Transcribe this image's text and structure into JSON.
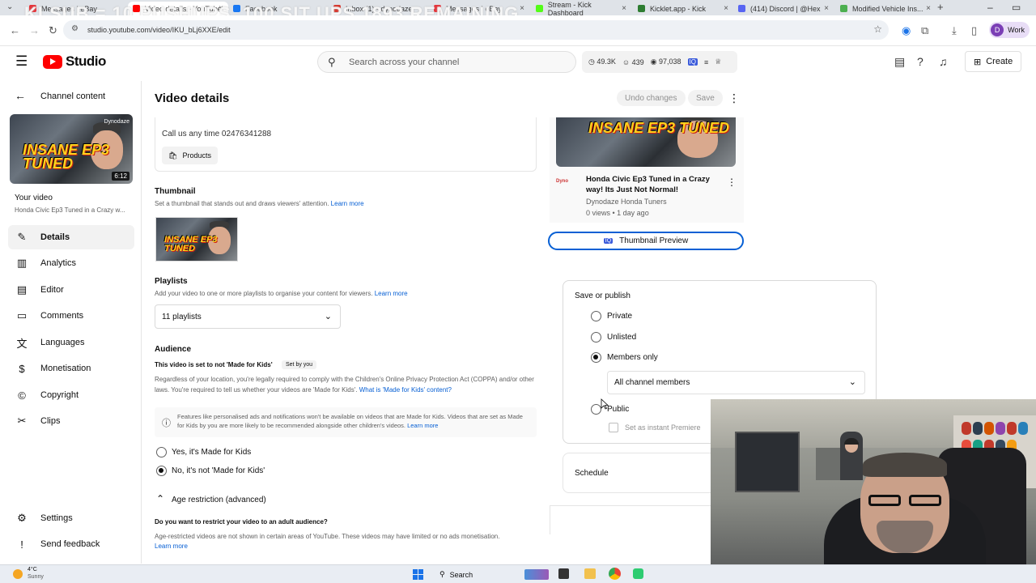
{
  "browser": {
    "overlay_text": "KI SUB = 10 PUSHUPS, 100 SIT UPS 1893 REMAINING",
    "tabs": [
      {
        "label": "Messages | eBay",
        "color": "#e53238"
      },
      {
        "label": "Video details - YouTube",
        "color": "#ff0000"
      },
      {
        "label": "Facebook",
        "color": "#1877f2"
      },
      {
        "label": "Inbox (1) - dynodaze",
        "color": "#d93025"
      },
      {
        "label": "Messages | eBay",
        "color": "#e53238"
      },
      {
        "label": "Stream - Kick Dashboard",
        "color": "#53fc18"
      },
      {
        "label": "Kicklet.app - Kick",
        "color": "#2e7d32"
      },
      {
        "label": "(414) Discord | @Hex",
        "color": "#5865f2"
      },
      {
        "label": "Modified Vehicle Ins...",
        "color": "#4caf50"
      }
    ],
    "url": "studio.youtube.com/video/IKU_bLj6XXE/edit",
    "profile_label": "Work",
    "profile_initial": "D"
  },
  "header": {
    "logo_text": "Studio",
    "search_placeholder": "Search across your channel",
    "stats": {
      "views_clock": "49.3K",
      "subs": "439",
      "views": "97,038"
    },
    "create_label": "Create"
  },
  "sidebar": {
    "back_label": "Channel content",
    "thumb_title": "INSANE EP3 TUNED",
    "thumb_brand": "Dynodaze",
    "duration": "6:12",
    "your_video_label": "Your video",
    "video_title_short": "Honda Civic Ep3 Tuned in a Crazy w...",
    "items": [
      {
        "label": "Details",
        "icon": "pencil-icon",
        "glyph": "✎"
      },
      {
        "label": "Analytics",
        "icon": "analytics-icon",
        "glyph": "▥"
      },
      {
        "label": "Editor",
        "icon": "editor-icon",
        "glyph": "▤"
      },
      {
        "label": "Comments",
        "icon": "comments-icon",
        "glyph": "▭"
      },
      {
        "label": "Languages",
        "icon": "languages-icon",
        "glyph": "文"
      },
      {
        "label": "Monetisation",
        "icon": "monetisation-icon",
        "glyph": "$"
      },
      {
        "label": "Copyright",
        "icon": "copyright-icon",
        "glyph": "©"
      },
      {
        "label": "Clips",
        "icon": "scissors-icon",
        "glyph": "✂"
      }
    ],
    "settings_label": "Settings",
    "feedback_label": "Send feedback"
  },
  "main": {
    "title": "Video details",
    "undo_label": "Undo changes",
    "save_label": "Save",
    "description_line": "Call us any time 02476341288",
    "products_label": "Products",
    "thumbnail": {
      "title": "Thumbnail",
      "subtitle": "Set a thumbnail that stands out and draws viewers' attention.",
      "learn_more": "Learn more"
    },
    "playlists": {
      "title": "Playlists",
      "subtitle": "Add your video to one or more playlists to organise your content for viewers.",
      "learn_more": "Learn more",
      "value": "11 playlists"
    },
    "audience": {
      "title": "Audience",
      "status": "This video is set to not 'Made for Kids'",
      "set_by": "Set by you",
      "body": "Regardless of your location, you're legally required to comply with the Children's Online Privacy Protection Act (COPPA) and/or other laws. You're required to tell us whether your videos are 'Made for Kids'.",
      "what_is_link": "What is 'Made for Kids' content?",
      "info": "Features like personalised ads and notifications won't be available on videos that are Made for Kids. Videos that are set as Made for Kids by you are more likely to be recommended alongside other children's videos.",
      "info_link": "Learn more",
      "option_yes": "Yes, it's Made for Kids",
      "option_no": "No, it's not 'Made for Kids'"
    },
    "age_restriction": {
      "title": "Age restriction (advanced)",
      "question": "Do you want to restrict your video to an adult audience?",
      "body": "Age-restricted videos are not shown in certain areas of YouTube. These videos may have limited or no ads monetisation.",
      "learn_more": "Learn more"
    }
  },
  "preview": {
    "title": "Honda Civic Ep3 Tuned in a Crazy way! Its Just Not Normal!",
    "channel": "Dynodaze Honda Tuners",
    "meta": "0 views • 1 day ago",
    "thumb_title": "INSANE EP3 TUNED",
    "thumbnail_preview_label": "Thumbnail Preview"
  },
  "visibility": {
    "title": "Save or publish",
    "options": [
      "Private",
      "Unlisted",
      "Members only",
      "Public"
    ],
    "selected": "Members only",
    "members_value": "All channel members",
    "premiere_label": "Set as instant Premiere",
    "schedule_label": "Schedule"
  },
  "taskbar": {
    "weather_temp": "4°C",
    "weather_desc": "Sunny",
    "search_label": "Search"
  },
  "colors": {
    "accent_blue": "#065fd4",
    "youtube_red": "#ff0000"
  }
}
